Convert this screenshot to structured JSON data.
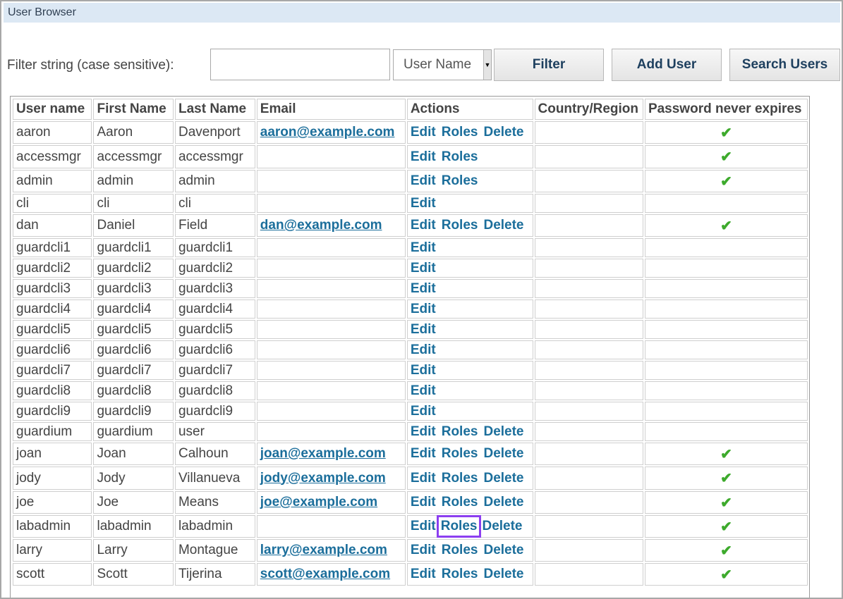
{
  "window": {
    "title": "User Browser"
  },
  "filter": {
    "label": "Filter string (case sensitive):",
    "input_value": "",
    "select_value": "User Name",
    "filter_button": "Filter",
    "add_user_button": "Add User",
    "search_users_button": "Search Users"
  },
  "table": {
    "headers": [
      "User name",
      "First Name",
      "Last Name",
      "Email",
      "Actions",
      "Country/Region",
      "Password never expires"
    ],
    "rows": [
      {
        "user": "aaron",
        "first": "Aaron",
        "last": "Davenport",
        "email": "aaron@example.com",
        "actions": [
          "Edit",
          "Roles",
          "Delete"
        ],
        "country": "",
        "never": true
      },
      {
        "user": "accessmgr",
        "first": "accessmgr",
        "last": "accessmgr",
        "email": "",
        "actions": [
          "Edit",
          "Roles"
        ],
        "country": "",
        "never": true
      },
      {
        "user": "admin",
        "first": "admin",
        "last": "admin",
        "email": "",
        "actions": [
          "Edit",
          "Roles"
        ],
        "country": "",
        "never": true
      },
      {
        "user": "cli",
        "first": "cli",
        "last": "cli",
        "email": "",
        "actions": [
          "Edit"
        ],
        "country": "",
        "never": false
      },
      {
        "user": "dan",
        "first": "Daniel",
        "last": "Field",
        "email": "dan@example.com",
        "actions": [
          "Edit",
          "Roles",
          "Delete"
        ],
        "country": "",
        "never": true
      },
      {
        "user": "guardcli1",
        "first": "guardcli1",
        "last": "guardcli1",
        "email": "",
        "actions": [
          "Edit"
        ],
        "country": "",
        "never": false
      },
      {
        "user": "guardcli2",
        "first": "guardcli2",
        "last": "guardcli2",
        "email": "",
        "actions": [
          "Edit"
        ],
        "country": "",
        "never": false
      },
      {
        "user": "guardcli3",
        "first": "guardcli3",
        "last": "guardcli3",
        "email": "",
        "actions": [
          "Edit"
        ],
        "country": "",
        "never": false
      },
      {
        "user": "guardcli4",
        "first": "guardcli4",
        "last": "guardcli4",
        "email": "",
        "actions": [
          "Edit"
        ],
        "country": "",
        "never": false
      },
      {
        "user": "guardcli5",
        "first": "guardcli5",
        "last": "guardcli5",
        "email": "",
        "actions": [
          "Edit"
        ],
        "country": "",
        "never": false
      },
      {
        "user": "guardcli6",
        "first": "guardcli6",
        "last": "guardcli6",
        "email": "",
        "actions": [
          "Edit"
        ],
        "country": "",
        "never": false
      },
      {
        "user": "guardcli7",
        "first": "guardcli7",
        "last": "guardcli7",
        "email": "",
        "actions": [
          "Edit"
        ],
        "country": "",
        "never": false
      },
      {
        "user": "guardcli8",
        "first": "guardcli8",
        "last": "guardcli8",
        "email": "",
        "actions": [
          "Edit"
        ],
        "country": "",
        "never": false
      },
      {
        "user": "guardcli9",
        "first": "guardcli9",
        "last": "guardcli9",
        "email": "",
        "actions": [
          "Edit"
        ],
        "country": "",
        "never": false
      },
      {
        "user": "guardium",
        "first": "guardium",
        "last": "user",
        "email": "",
        "actions": [
          "Edit",
          "Roles",
          "Delete"
        ],
        "country": "",
        "never": false
      },
      {
        "user": "joan",
        "first": "Joan",
        "last": "Calhoun",
        "email": "joan@example.com",
        "actions": [
          "Edit",
          "Roles",
          "Delete"
        ],
        "country": "",
        "never": true
      },
      {
        "user": "jody",
        "first": "Jody",
        "last": "Villanueva",
        "email": "jody@example.com",
        "actions": [
          "Edit",
          "Roles",
          "Delete"
        ],
        "country": "",
        "never": true
      },
      {
        "user": "joe",
        "first": "Joe",
        "last": "Means",
        "email": "joe@example.com",
        "actions": [
          "Edit",
          "Roles",
          "Delete"
        ],
        "country": "",
        "never": true
      },
      {
        "user": "labadmin",
        "first": "labadmin",
        "last": "labadmin",
        "email": "",
        "actions": [
          "Edit",
          "Roles",
          "Delete"
        ],
        "country": "",
        "never": true,
        "highlight_action": "Roles"
      },
      {
        "user": "larry",
        "first": "Larry",
        "last": "Montague",
        "email": "larry@example.com",
        "actions": [
          "Edit",
          "Roles",
          "Delete"
        ],
        "country": "",
        "never": true
      },
      {
        "user": "scott",
        "first": "Scott",
        "last": "Tijerina",
        "email": "scott@example.com",
        "actions": [
          "Edit",
          "Roles",
          "Delete"
        ],
        "country": "",
        "never": true
      }
    ]
  },
  "icons": {
    "check": "check-icon",
    "check_color": "#3daa2c",
    "highlight_color": "#8c3ff0"
  }
}
